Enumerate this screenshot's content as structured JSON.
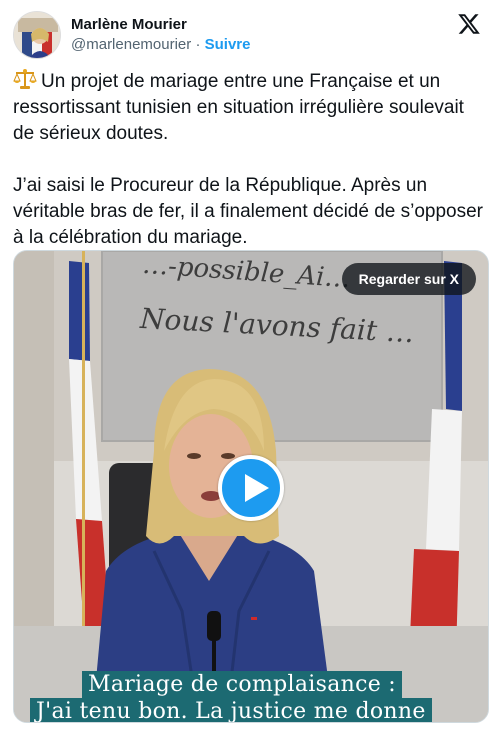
{
  "author": {
    "display_name": "Marlène Mourier",
    "handle": "@marlenemourier",
    "separator": "·",
    "follow_label": "Suivre"
  },
  "brand_icon": "x-logo-icon",
  "tweet": {
    "emoji": "scale-emoji-icon",
    "paragraph1": "Un projet de mariage entre une Française et un ressortissant tunisien en situation irrégulière soulevait de sérieux doutes.",
    "paragraph2": "J’ai saisi le Procureur de la République. Après un véritable bras de fer, il a finalement décidé de s’opposer à la célébration du mariage."
  },
  "media": {
    "watch_label": "Regarder sur X",
    "play_icon": "play-icon",
    "caption_line1": "Mariage de complaisance :",
    "caption_line2": "J'ai tenu bon. La justice me donne",
    "plaque_line1": "…-possible_Ai…",
    "plaque_line2": "Nous l'avons fait …"
  },
  "colors": {
    "accent": "#1d9bf0",
    "text": "#0f1419",
    "secondary": "#536471",
    "caption_bg": "#1c6a72"
  }
}
